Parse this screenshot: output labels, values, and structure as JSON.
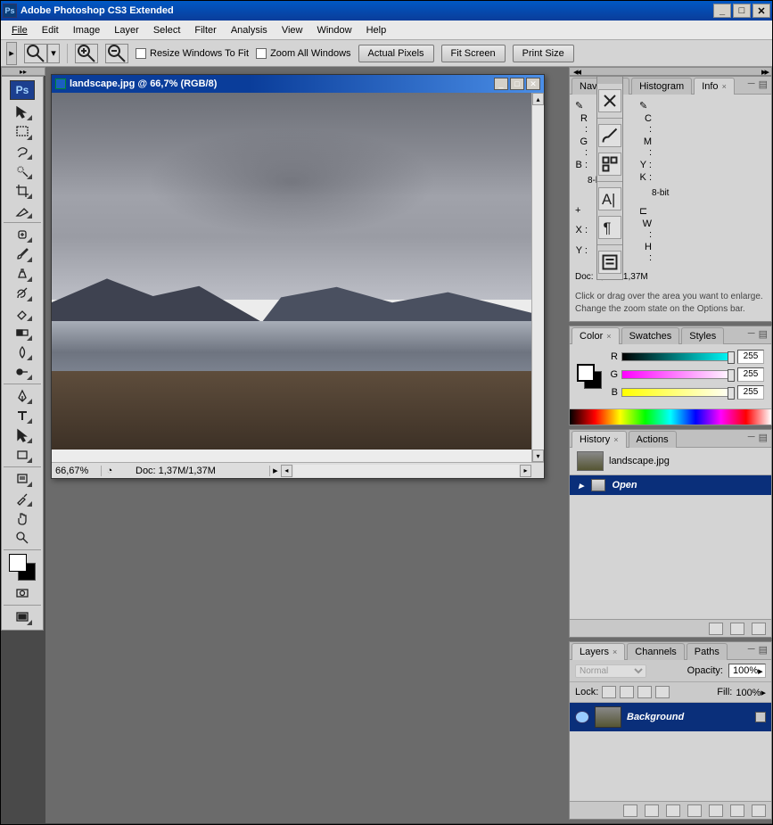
{
  "app_title": "Adobe Photoshop CS3 Extended",
  "ps_badge": "Ps",
  "menu": [
    "File",
    "Edit",
    "Image",
    "Layer",
    "Select",
    "Filter",
    "Analysis",
    "View",
    "Window",
    "Help"
  ],
  "options_bar": {
    "resize_label": "Resize Windows To Fit",
    "zoom_all_label": "Zoom All Windows",
    "actual_pixels": "Actual Pixels",
    "fit_screen": "Fit Screen",
    "print_size": "Print Size"
  },
  "document": {
    "title": "landscape.jpg @ 66,7% (RGB/8)",
    "zoom": "66,67%",
    "doc_size": "Doc: 1,37M/1,37M"
  },
  "panels": {
    "navigator": "Navigator",
    "histogram": "Histogram",
    "info": {
      "tab": "Info",
      "R": "R :",
      "G": "G :",
      "B": "B :",
      "C": "C :",
      "M": "M :",
      "Y": "Y :",
      "K": "K :",
      "bit_left": "8-bit",
      "bit_right": "8-bit",
      "X": "X :",
      "Y_": "Y :",
      "W": "W :",
      "H": "H :",
      "doc": "Doc: 1,37M/1,37M",
      "hint": "Click or drag over the area you want to enlarge. Change the zoom state on the Options bar."
    },
    "color": {
      "tab": "Color",
      "swatches": "Swatches",
      "styles": "Styles",
      "R": "R",
      "G": "G",
      "B": "B",
      "val_r": "255",
      "val_g": "255",
      "val_b": "255"
    },
    "history": {
      "tab": "History",
      "actions": "Actions",
      "doc_name": "landscape.jpg",
      "state_open": "Open"
    },
    "layers": {
      "tab": "Layers",
      "channels": "Channels",
      "paths": "Paths",
      "blend_mode": "Normal",
      "opacity_lbl": "Opacity:",
      "opacity_val": "100%",
      "lock_lbl": "Lock:",
      "fill_lbl": "Fill:",
      "fill_val": "100%",
      "bg_layer": "Background"
    }
  }
}
